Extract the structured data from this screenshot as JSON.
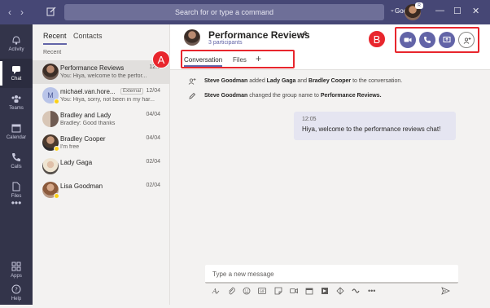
{
  "titlebar": {
    "back": "‹",
    "forward": "›",
    "search_placeholder": "Search for or type a command",
    "org": "Goo...",
    "org_chevron": "⌄",
    "badge": "R",
    "minimize": "—",
    "maximize": "☐",
    "close": "✕"
  },
  "appbar": {
    "items": [
      {
        "label": "Activity",
        "icon": "bell-icon"
      },
      {
        "label": "Chat",
        "icon": "chat-icon"
      },
      {
        "label": "Teams",
        "icon": "teams-icon"
      },
      {
        "label": "Calendar",
        "icon": "calendar-icon"
      },
      {
        "label": "Calls",
        "icon": "phone-icon"
      },
      {
        "label": "Files",
        "icon": "files-icon"
      },
      {
        "label": "•••",
        "icon": "more-icon"
      }
    ],
    "apps": "Apps",
    "help": "Help"
  },
  "list": {
    "tabs": [
      "Recent",
      "Contacts"
    ],
    "section_header": "Recent",
    "chats": [
      {
        "name": "Performance Reviews",
        "preview": "You: Hiya, welcome to the perfor...",
        "date": "12:0",
        "selected": true
      },
      {
        "name": "michael.van.hore...",
        "preview": "You: Hiya, sorry, not been in my har...",
        "date": "12/04",
        "external": "External"
      },
      {
        "name": "Bradley and Lady",
        "preview": "Bradley: Good thanks",
        "date": "04/04"
      },
      {
        "name": "Bradley Cooper",
        "preview": "I'm free",
        "date": "04/04"
      },
      {
        "name": "Lady Gaga",
        "preview": "",
        "date": "02/04"
      },
      {
        "name": "Lisa Goodman",
        "preview": "",
        "date": "02/04"
      }
    ],
    "michael_initials": "M"
  },
  "main": {
    "title": "Performance Reviews",
    "subtitle": "3 participants",
    "tabs": [
      "Conversation",
      "Files"
    ],
    "add_tab": "+",
    "annotation_a": "A",
    "annotation_b": "B",
    "events": [
      {
        "actor": "Steve Goodman",
        "text1": " added ",
        "t1": "Lady Gaga",
        "text2": " and ",
        "t2": "Bradley Cooper",
        "text3": " to the conversation."
      },
      {
        "actor": "Steve Goodman",
        "text1": " changed the group name to ",
        "t1": "Performance Reviews."
      }
    ],
    "message": {
      "time": "12:05",
      "text": "Hiya, welcome to the performance reviews chat!"
    },
    "compose_placeholder": "Type a new message"
  },
  "colors": {
    "brand": "#6264a7",
    "titlebar": "#464775",
    "appbar": "#33344a",
    "annotation": "#e8262d"
  }
}
